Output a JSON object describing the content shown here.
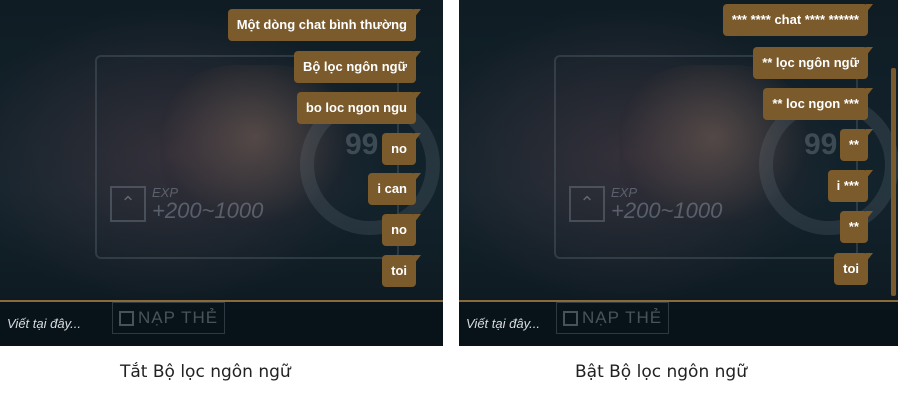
{
  "left_panel": {
    "messages": [
      "Một dòng chat bình thường",
      "Bộ lọc ngôn ngữ",
      "bo loc ngon ngu",
      "no",
      "i can",
      "no",
      "toi"
    ],
    "input_placeholder": "Viết tại đây...",
    "background_button": "NẠP THẺ",
    "background_exp_label": "EXP",
    "background_exp_value": "+200~1000",
    "caption": "Tắt Bộ lọc ngôn ngữ"
  },
  "right_panel": {
    "messages": [
      "*** **** chat **** ******",
      "** lọc ngôn ngữ",
      "** loc ngon ***",
      "**",
      "i ***",
      "**",
      "toi"
    ],
    "input_placeholder": "Viết tại đây...",
    "background_button": "NẠP THẺ",
    "background_exp_label": "EXP",
    "background_exp_value": "+200~1000",
    "caption": "Bật Bộ lọc ngôn ngữ"
  },
  "colors": {
    "bubble": "#7b5a2c",
    "accent_line": "#8a6a3a",
    "panel_bg": "#13232c"
  }
}
